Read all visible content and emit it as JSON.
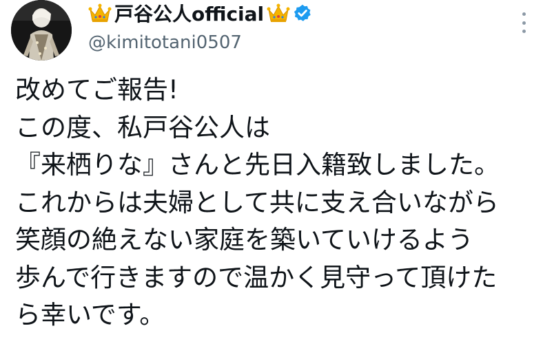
{
  "author": {
    "display_name": "戸谷公人official",
    "handle": "@kimitotani0507",
    "badge_icon": "crown-icon",
    "verified_icon": "verified-badge-icon",
    "verified_color": "#1d9bf0",
    "crown_color": "#f5b400"
  },
  "more_button": {
    "icon": "more-vertical-icon"
  },
  "tweet": {
    "lines": [
      "改めてご報告!",
      "この度、私戸谷公人は",
      "『来栖りな』さんと先日入籍致しました。",
      "これからは夫婦として共に支え合いながら",
      "笑顔の絶えない家庭を築いていけるよう",
      "歩んで行きますので温かく見守って頂けた",
      "ら幸いです。"
    ]
  }
}
